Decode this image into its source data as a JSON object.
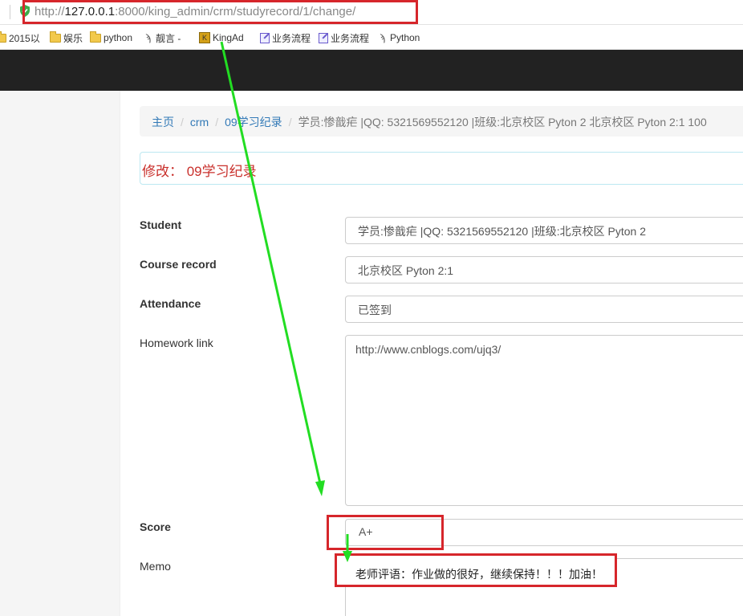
{
  "browser": {
    "url_prefix": "http://",
    "url_host": "127.0.0.1",
    "url_rest": ":8000/king_admin/crm/studyrecord/1/change/"
  },
  "bookmarks": [
    {
      "label": "2015以",
      "icon": "folder-icon"
    },
    {
      "label": "娱乐",
      "icon": "folder-icon"
    },
    {
      "label": "python",
      "icon": "folder-icon"
    },
    {
      "label": "靓言 -",
      "icon": "python-icon"
    },
    {
      "label": "KingAd",
      "icon": "kingad-icon"
    },
    {
      "label": "业务流程",
      "icon": "edit-icon"
    },
    {
      "label": "业务流程",
      "icon": "edit-icon"
    },
    {
      "label": "Python",
      "icon": "python-icon"
    }
  ],
  "breadcrumb": {
    "home": "主页",
    "app": "crm",
    "model": "09学习纪录",
    "current": "学员:惨戠疟 |QQ: 5321569552120 |班级:北京校区 Pyton 2 北京校区 Pyton 2:1 100"
  },
  "page_title": "修改：  09学习纪录",
  "form": {
    "student": {
      "label": "Student",
      "value": "学员:惨戠疟 |QQ: 5321569552120 |班级:北京校区 Pyton 2"
    },
    "course_record": {
      "label": "Course record",
      "value": "北京校区 Pyton 2:1"
    },
    "attendance": {
      "label": "Attendance",
      "value": "已签到"
    },
    "homework_link": {
      "label": "Homework link",
      "value": "http://www.cnblogs.com/ujq3/"
    },
    "score": {
      "label": "Score",
      "value": "A+"
    },
    "memo": {
      "label": "Memo",
      "value": "老师评语：作业做的很好，继续保持！！！加油！"
    }
  },
  "colors": {
    "annotation_red": "#d6262b",
    "annotation_green": "#22dd22",
    "navbar": "#222222",
    "link": "#337ab7",
    "title_red": "#c9302c"
  }
}
